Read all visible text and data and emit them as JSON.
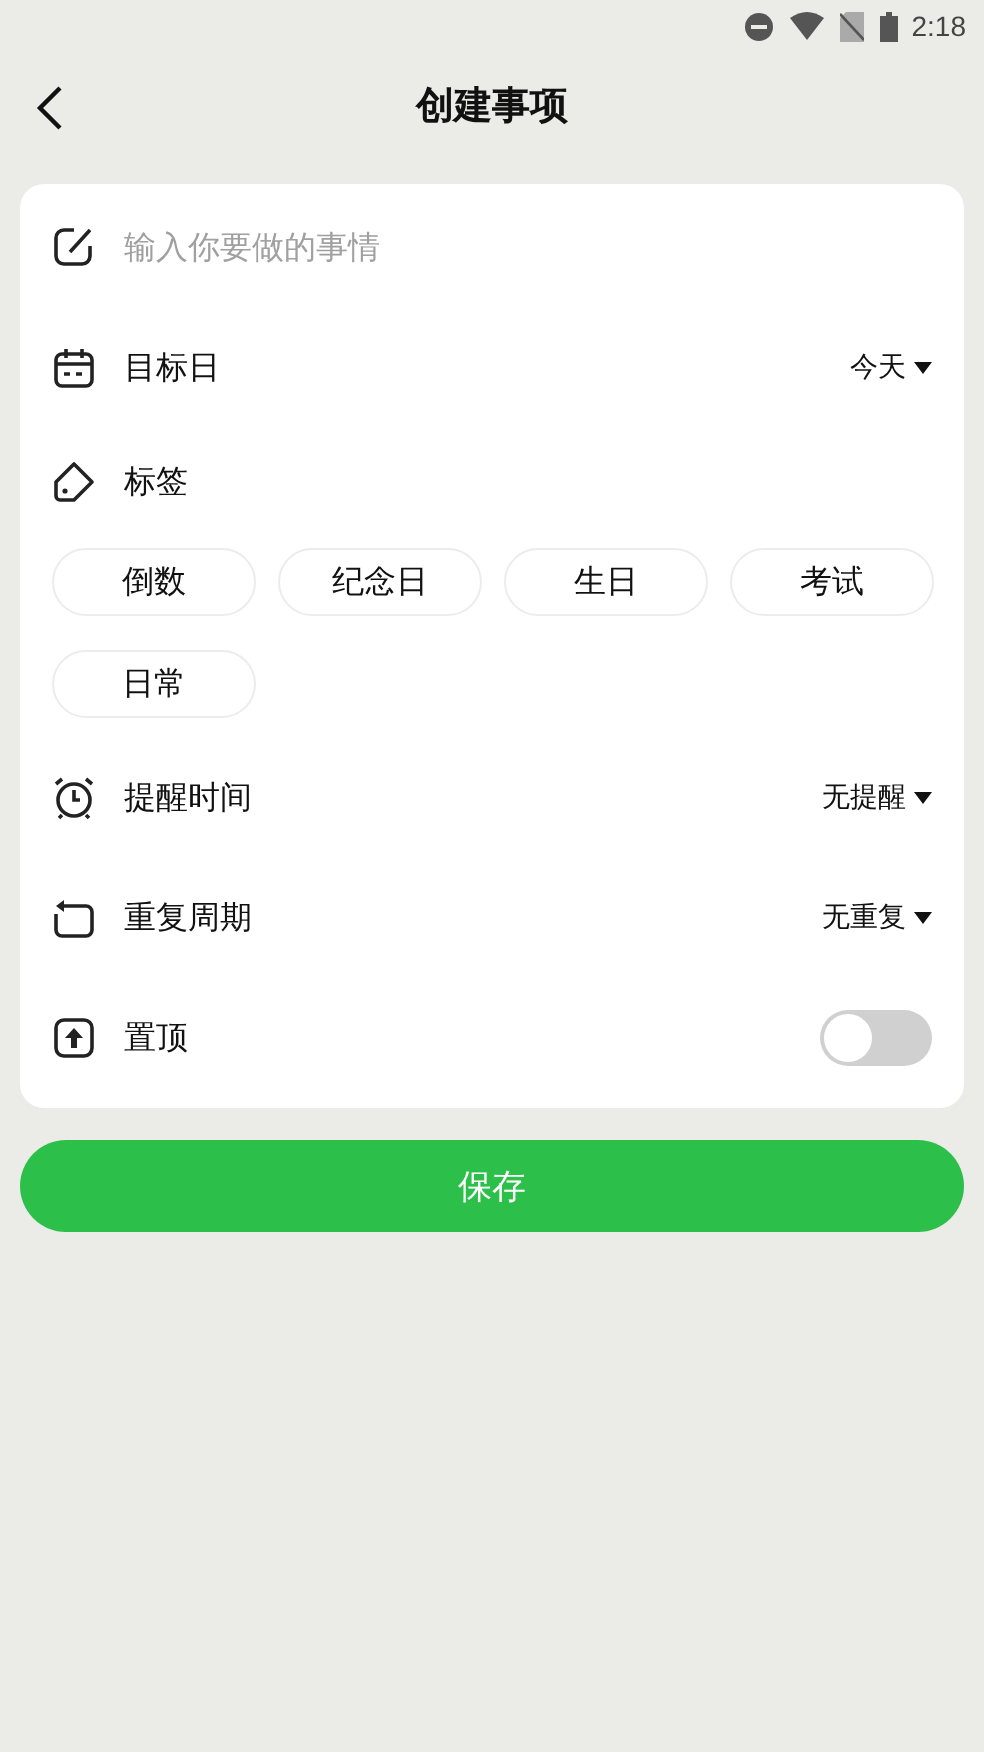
{
  "status_bar": {
    "time": "2:18"
  },
  "header": {
    "title": "创建事项"
  },
  "input": {
    "placeholder": "输入你要做的事情"
  },
  "rows": [
    {
      "kind": "date",
      "label": "目标日",
      "value": "今天"
    },
    {
      "kind": "tags",
      "label": "标签",
      "tags": [
        {
          "label": "倒数",
          "selected": false
        },
        {
          "label": "纪念日",
          "selected": false
        },
        {
          "label": "生日",
          "selected": false
        },
        {
          "label": "考试",
          "selected": false
        },
        {
          "label": "日常",
          "selected": false
        }
      ]
    },
    {
      "kind": "alarm",
      "label": "提醒时间",
      "value": "无提醒"
    },
    {
      "kind": "repeat",
      "label": "重复周期",
      "value": "无重复"
    },
    {
      "kind": "toggle",
      "label": "置顶",
      "on": false
    }
  ],
  "save_button": "保存"
}
